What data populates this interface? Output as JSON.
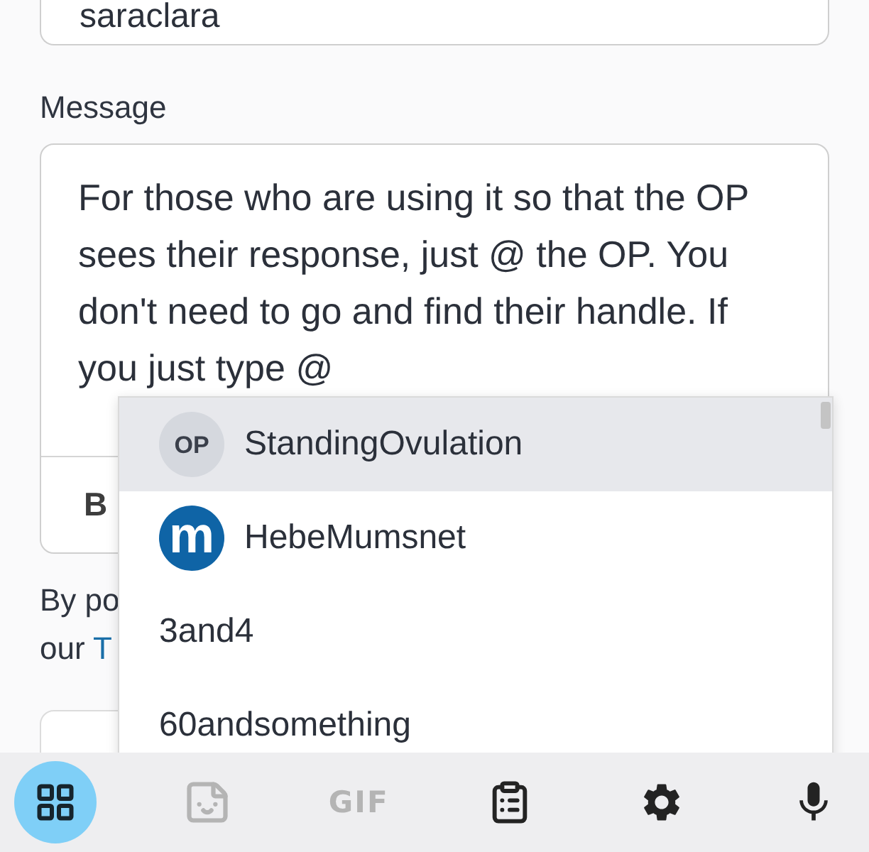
{
  "author_field": {
    "value": "saraclara"
  },
  "message": {
    "label": "Message",
    "text": "For those who are using it so that the OP sees their response, just @ the OP. You don't need to go and find their handle. If you just type @"
  },
  "format_toolbar": {
    "buttons": [
      {
        "label": "B"
      }
    ]
  },
  "terms": {
    "line_1": "By po",
    "line_2": "our",
    "link": "T"
  },
  "mention_menu": {
    "options": [
      {
        "name": "StandingOvulation",
        "selected": true,
        "avatar": {
          "kind": "initials",
          "text": "OP"
        }
      },
      {
        "name": "HebeMumsnet",
        "selected": false,
        "avatar": {
          "kind": "logo",
          "text": "m"
        }
      },
      {
        "name": "3and4",
        "selected": false
      },
      {
        "name": "60andsomething",
        "selected": false
      }
    ]
  },
  "keyboard": {
    "tools": [
      {
        "kind": "apps",
        "selected": true,
        "disabled": false
      },
      {
        "kind": "sticker",
        "selected": false,
        "disabled": true
      },
      {
        "kind": "gif",
        "label": "GIF",
        "selected": false,
        "disabled": true
      },
      {
        "kind": "clipboard",
        "selected": false,
        "disabled": false
      },
      {
        "kind": "settings",
        "selected": false,
        "disabled": false
      },
      {
        "kind": "voice",
        "selected": false,
        "disabled": false
      }
    ]
  }
}
